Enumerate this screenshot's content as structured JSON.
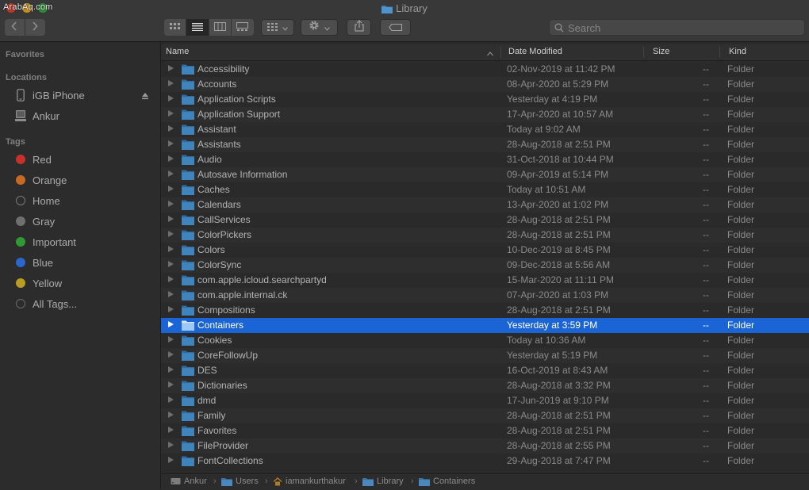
{
  "watermark": "ArabAq.com",
  "window": {
    "title": "Library"
  },
  "toolbar": {
    "search_placeholder": "Search"
  },
  "sidebar": {
    "favorites_heading": "Favorites",
    "locations_heading": "Locations",
    "tags_heading": "Tags",
    "locations": [
      {
        "label": "iGB iPhone",
        "icon": "iphone-icon"
      },
      {
        "label": "Ankur",
        "icon": "computer-icon"
      }
    ],
    "tags": [
      {
        "label": "Red",
        "color": "#c6322b"
      },
      {
        "label": "Orange",
        "color": "#c76a22"
      },
      {
        "label": "Home",
        "color": "none"
      },
      {
        "label": "Gray",
        "color": "#6f6f6f"
      },
      {
        "label": "Important",
        "color": "#2f9a33"
      },
      {
        "label": "Blue",
        "color": "#2a66cc"
      },
      {
        "label": "Yellow",
        "color": "#bb9d22"
      },
      {
        "label": "All Tags...",
        "color": "none"
      }
    ]
  },
  "columns": {
    "name": "Name",
    "date": "Date Modified",
    "size": "Size",
    "kind": "Kind"
  },
  "files": [
    {
      "name": "Accessibility",
      "date": "02-Nov-2019 at 11:42 PM",
      "size": "--",
      "kind": "Folder"
    },
    {
      "name": "Accounts",
      "date": "08-Apr-2020 at 5:29 PM",
      "size": "--",
      "kind": "Folder"
    },
    {
      "name": "Application Scripts",
      "date": "Yesterday at 4:19 PM",
      "size": "--",
      "kind": "Folder"
    },
    {
      "name": "Application Support",
      "date": "17-Apr-2020 at 10:57 AM",
      "size": "--",
      "kind": "Folder"
    },
    {
      "name": "Assistant",
      "date": "Today at 9:02 AM",
      "size": "--",
      "kind": "Folder"
    },
    {
      "name": "Assistants",
      "date": "28-Aug-2018 at 2:51 PM",
      "size": "--",
      "kind": "Folder"
    },
    {
      "name": "Audio",
      "date": "31-Oct-2018 at 10:44 PM",
      "size": "--",
      "kind": "Folder"
    },
    {
      "name": "Autosave Information",
      "date": "09-Apr-2019 at 5:14 PM",
      "size": "--",
      "kind": "Folder"
    },
    {
      "name": "Caches",
      "date": "Today at 10:51 AM",
      "size": "--",
      "kind": "Folder"
    },
    {
      "name": "Calendars",
      "date": "13-Apr-2020 at 1:02 PM",
      "size": "--",
      "kind": "Folder"
    },
    {
      "name": "CallServices",
      "date": "28-Aug-2018 at 2:51 PM",
      "size": "--",
      "kind": "Folder"
    },
    {
      "name": "ColorPickers",
      "date": "28-Aug-2018 at 2:51 PM",
      "size": "--",
      "kind": "Folder"
    },
    {
      "name": "Colors",
      "date": "10-Dec-2019 at 8:45 PM",
      "size": "--",
      "kind": "Folder"
    },
    {
      "name": "ColorSync",
      "date": "09-Dec-2018 at 5:56 AM",
      "size": "--",
      "kind": "Folder"
    },
    {
      "name": "com.apple.icloud.searchpartyd",
      "date": "15-Mar-2020 at 11:11 PM",
      "size": "--",
      "kind": "Folder"
    },
    {
      "name": "com.apple.internal.ck",
      "date": "07-Apr-2020 at 1:03 PM",
      "size": "--",
      "kind": "Folder"
    },
    {
      "name": "Compositions",
      "date": "28-Aug-2018 at 2:51 PM",
      "size": "--",
      "kind": "Folder"
    },
    {
      "name": "Containers",
      "date": "Yesterday at 3:59 PM",
      "size": "--",
      "kind": "Folder",
      "selected": true
    },
    {
      "name": "Cookies",
      "date": "Today at 10:36 AM",
      "size": "--",
      "kind": "Folder"
    },
    {
      "name": "CoreFollowUp",
      "date": "Yesterday at 5:19 PM",
      "size": "--",
      "kind": "Folder"
    },
    {
      "name": "DES",
      "date": "16-Oct-2019 at 8:43 AM",
      "size": "--",
      "kind": "Folder"
    },
    {
      "name": "Dictionaries",
      "date": "28-Aug-2018 at 3:32 PM",
      "size": "--",
      "kind": "Folder"
    },
    {
      "name": "dmd",
      "date": "17-Jun-2019 at 9:10 PM",
      "size": "--",
      "kind": "Folder"
    },
    {
      "name": "Family",
      "date": "28-Aug-2018 at 2:51 PM",
      "size": "--",
      "kind": "Folder"
    },
    {
      "name": "Favorites",
      "date": "28-Aug-2018 at 2:51 PM",
      "size": "--",
      "kind": "Folder"
    },
    {
      "name": "FileProvider",
      "date": "28-Aug-2018 at 2:55 PM",
      "size": "--",
      "kind": "Folder"
    },
    {
      "name": "FontCollections",
      "date": "29-Aug-2018 at 7:47 PM",
      "size": "--",
      "kind": "Folder"
    }
  ],
  "path": [
    {
      "label": "Ankur",
      "icon": "disk-icon"
    },
    {
      "label": "Users",
      "icon": "folder-icon"
    },
    {
      "label": "iamankurthakur",
      "icon": "home-icon"
    },
    {
      "label": "Library",
      "icon": "folder-icon"
    },
    {
      "label": "Containers",
      "icon": "folder-icon"
    }
  ]
}
